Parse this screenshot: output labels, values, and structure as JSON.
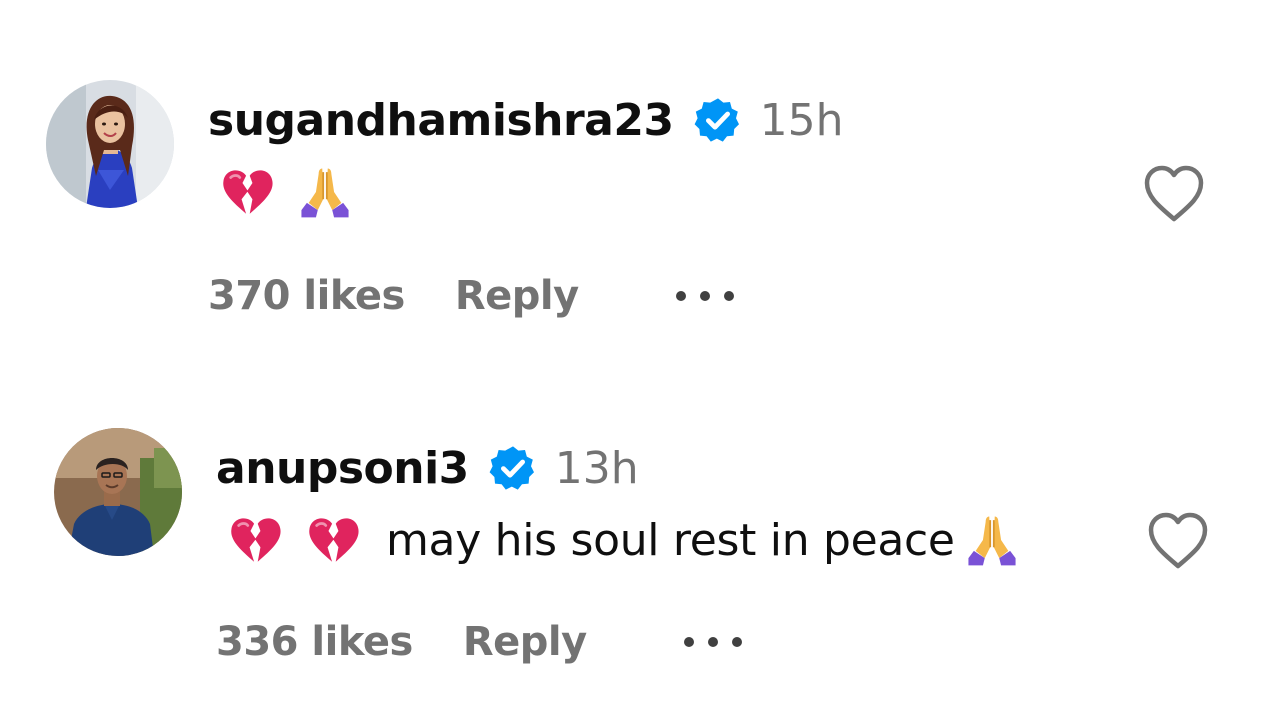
{
  "comments": [
    {
      "username": "sugandhamishra23",
      "verified": true,
      "timestamp": "15h",
      "text": "",
      "likes": "370 likes",
      "reply_label": "Reply"
    },
    {
      "username": "anupsoni3",
      "verified": true,
      "timestamp": "13h",
      "text": "may his soul rest in peace",
      "likes": "336 likes",
      "reply_label": "Reply"
    }
  ],
  "icons": {
    "verified": "verified-badge-icon",
    "like": "heart-outline-icon",
    "more": "more-options-icon",
    "broken_heart": "broken-heart-emoji",
    "folded_hands": "folded-hands-emoji"
  },
  "colors": {
    "username": "#0f0f0f",
    "secondary_text": "#737373",
    "verified_blue": "#0095f6",
    "heart_outline": "#737373"
  }
}
